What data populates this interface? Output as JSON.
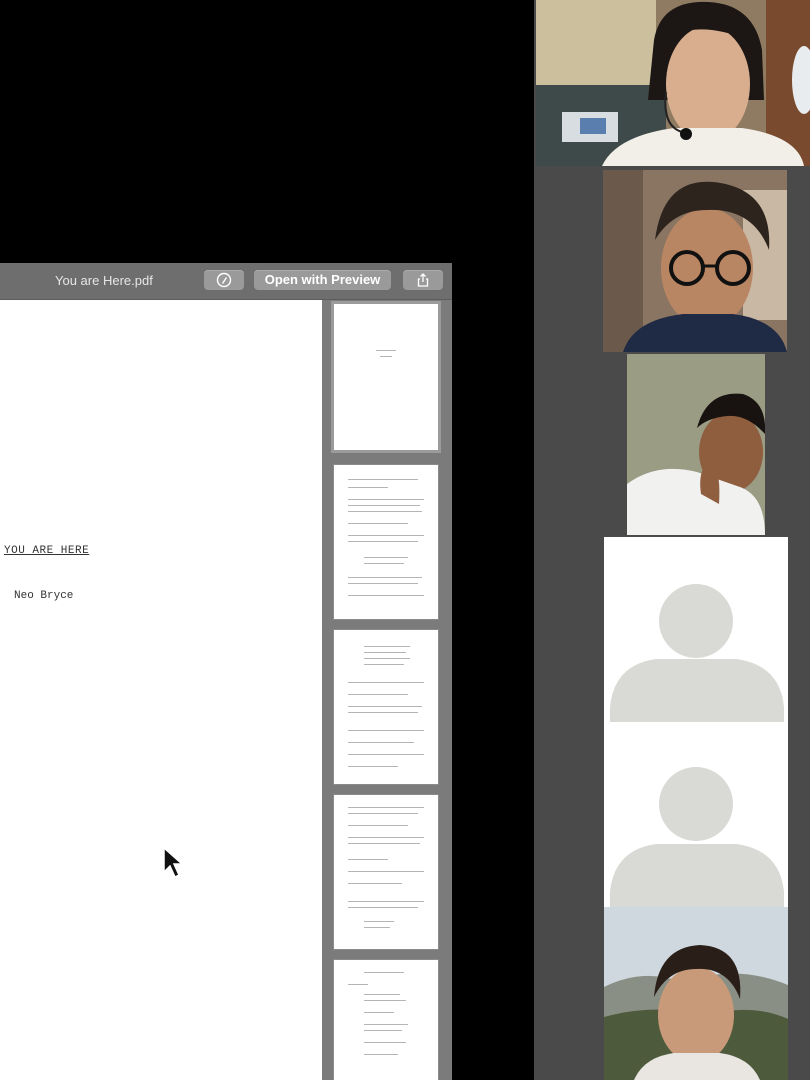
{
  "pdf_window": {
    "filename": "You are Here.pdf",
    "open_with_preview": "Open with Preview",
    "markup_icon": "markup-icon",
    "share_icon": "share-icon"
  },
  "document": {
    "title": "YOU ARE HERE",
    "author": "Neo Bryce"
  },
  "thumbnails": {
    "count": 5,
    "selected_page": 1
  },
  "participants": {
    "tiles": [
      {
        "kind": "video"
      },
      {
        "kind": "video"
      },
      {
        "kind": "video"
      },
      {
        "kind": "avatar",
        "icon": "default-avatar-icon"
      },
      {
        "kind": "avatar",
        "icon": "default-avatar-icon"
      },
      {
        "kind": "video"
      }
    ]
  }
}
